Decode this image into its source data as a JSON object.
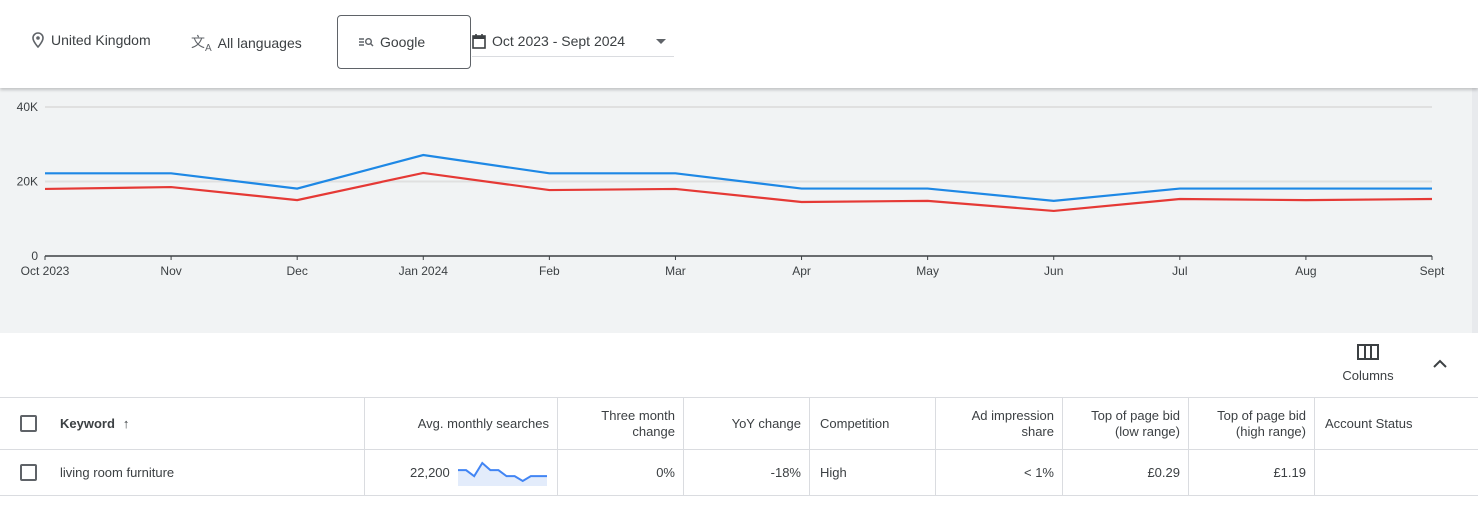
{
  "filters": {
    "location": "United Kingdom",
    "language": "All languages",
    "network": "Google",
    "date_range": "Oct 2023 - Sept 2024"
  },
  "chart_data": {
    "type": "line",
    "categories": [
      "Oct 2023",
      "Nov",
      "Dec",
      "Jan 2024",
      "Feb",
      "Mar",
      "Apr",
      "May",
      "Jun",
      "Jul",
      "Aug",
      "Sept"
    ],
    "yticks": [
      "0",
      "20K",
      "40K"
    ],
    "ylim": [
      0,
      40000
    ],
    "grid": true,
    "series": [
      {
        "color": "#1e88e5",
        "values": [
          22200,
          22200,
          18100,
          27100,
          22200,
          22200,
          18100,
          18100,
          14800,
          18100,
          18100,
          18100
        ]
      },
      {
        "color": "#e53935",
        "values": [
          18000,
          18500,
          15000,
          22300,
          17700,
          18000,
          14500,
          14800,
          12100,
          15300,
          15000,
          15300
        ]
      }
    ]
  },
  "toolbar": {
    "columns_label": "Columns"
  },
  "table": {
    "headers": {
      "keyword": "Keyword",
      "avg": "Avg. monthly searches",
      "three_month": "Three month change",
      "yoy": "YoY change",
      "competition": "Competition",
      "ad_share": "Ad impression share",
      "bid_low": "Top of page bid (low range)",
      "bid_high": "Top of page bid (high range)",
      "status": "Account Status"
    },
    "rows": [
      {
        "keyword": "living room furniture",
        "avg": "22,200",
        "trend": [
          22200,
          22200,
          18100,
          27100,
          22200,
          22200,
          18100,
          18100,
          14800,
          18100,
          18100,
          18100
        ],
        "three_month": "0%",
        "yoy": "-18%",
        "competition": "High",
        "ad_share": "< 1%",
        "bid_low": "£0.29",
        "bid_high": "£1.19",
        "status": ""
      }
    ]
  }
}
